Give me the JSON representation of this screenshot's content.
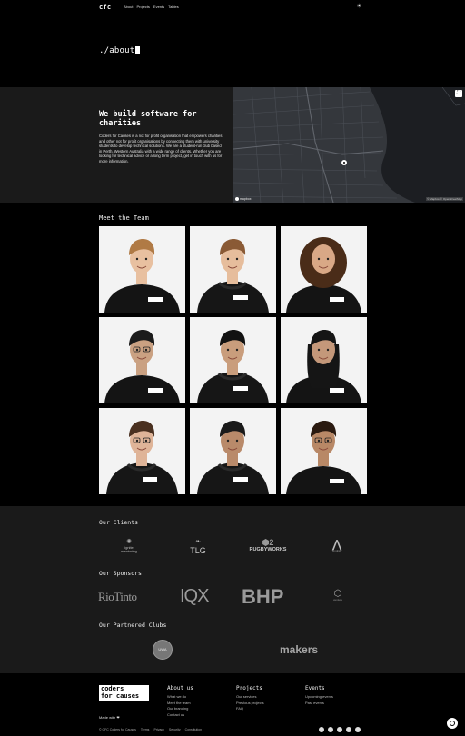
{
  "nav": {
    "logo": "cfc",
    "links": [
      "About",
      "Projects",
      "Events",
      "Tables"
    ],
    "theme_icon": "sun-icon"
  },
  "hero": {
    "title": "./about"
  },
  "about": {
    "heading": "We build software for charities",
    "body": "Coders for Causes is a not for profit organisation that empowers charities and other not for profit organisations by connecting them with university students to develop technical solutions. We are a student-run club based in Perth, Western Australia with a wide range of clients. Whether you are looking for technical advice or a long term project, get in touch with us for more information.",
    "map": {
      "attribution": "© Mapbox © OpenStreetMap",
      "brand": "mapbox"
    }
  },
  "team": {
    "title": "Meet the Team",
    "members": [
      {
        "hair": "#b07a45",
        "top": "tshirt",
        "skin": "#e8c0a0"
      },
      {
        "hair": "#8a5a35",
        "top": "hoodie",
        "skin": "#e6bd9c"
      },
      {
        "hair": "#4a2c18",
        "top": "tshirt",
        "skin": "#d9a886",
        "curly": true
      },
      {
        "hair": "#1b1b1b",
        "top": "tshirt",
        "skin": "#caa182",
        "glasses": true
      },
      {
        "hair": "#121212",
        "top": "hoodie",
        "skin": "#c99d7c"
      },
      {
        "hair": "#151515",
        "top": "tshirt",
        "skin": "#c4987a",
        "long": true
      },
      {
        "hair": "#4a3020",
        "top": "hoodie",
        "skin": "#dfb498",
        "glasses": true
      },
      {
        "hair": "#1a1a1a",
        "top": "hoodie",
        "skin": "#b98a6a"
      },
      {
        "hair": "#2a1a10",
        "top": "tshirt",
        "skin": "#b88866",
        "glasses": true
      }
    ]
  },
  "clients": {
    "title": "Our Clients",
    "items": [
      "ignite mentoring",
      "TLG",
      "RUGBYWORKS",
      "Angliss"
    ]
  },
  "sponsors": {
    "title": "Our Sponsors",
    "items": [
      "RioTinto",
      "IQX",
      "BHP",
      "venture"
    ]
  },
  "partners": {
    "title": "Our Partnered Clubs",
    "items": [
      "UWA",
      "makers"
    ]
  },
  "footer": {
    "logo_line1": "coders",
    "logo_line2": "for causes",
    "made_with": "Made with ❤",
    "cols": [
      {
        "title": "About us",
        "links": [
          "What we do",
          "Meet the team",
          "Our branding",
          "Contact us"
        ]
      },
      {
        "title": "Projects",
        "links": [
          "Our services",
          "Previous projects",
          "FAQ"
        ]
      },
      {
        "title": "Events",
        "links": [
          "Upcoming events",
          "Past events"
        ]
      }
    ],
    "legal": [
      "© CFC Coders for Causes",
      "Terms",
      "Privacy",
      "Security",
      "Constitution"
    ]
  }
}
